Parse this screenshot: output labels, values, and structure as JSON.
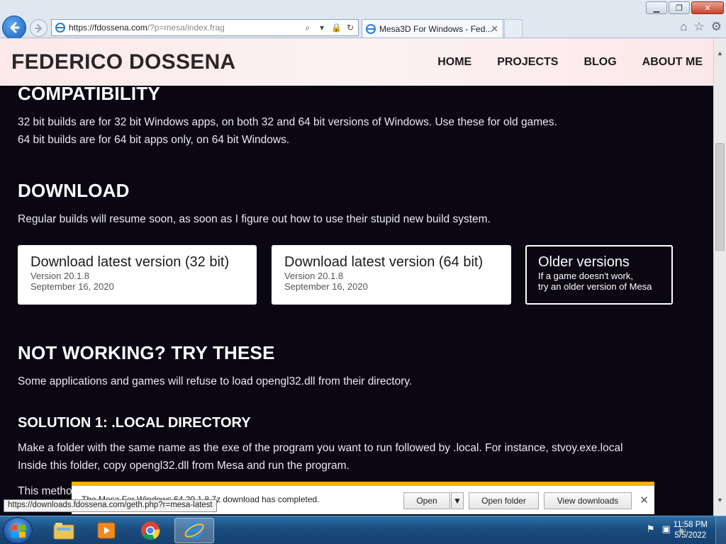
{
  "browser": {
    "url_main": "https://fdossena.com",
    "url_rest": "/?p=mesa/index.frag",
    "tab_title": "Mesa3D For Windows - Fed..."
  },
  "site": {
    "title": "FEDERICO DOSSENA",
    "menu": [
      "HOME",
      "PROJECTS",
      "BLOG",
      "ABOUT ME"
    ]
  },
  "sections": {
    "compatibility": {
      "heading": "COMPATIBILITY",
      "line1": "32 bit builds are for 32 bit Windows apps, on both 32 and 64 bit versions of Windows. Use these for old games.",
      "line2": "64 bit builds are for 64 bit apps only, on 64 bit Windows."
    },
    "download": {
      "heading": "DOWNLOAD",
      "text": "Regular builds will resume soon, as soon as I figure out how to use their stupid new build system.",
      "cards": [
        {
          "title": "Download latest version (32 bit)",
          "line1": "Version 20.1.8",
          "line2": "September 16, 2020"
        },
        {
          "title": "Download latest version (64 bit)",
          "line1": "Version 20.1.8",
          "line2": "September 16, 2020"
        },
        {
          "title": "Older versions",
          "line1": "If a game doesn't work,",
          "line2": "try an older version of Mesa"
        }
      ]
    },
    "notworking": {
      "heading": "NOT WORKING? TRY THESE",
      "text": "Some applications and games will refuse to load opengl32.dll from their directory."
    },
    "solution1": {
      "heading": "SOLUTION 1: .LOCAL DIRECTORY",
      "line1": "Make a folder with the same name as the exe of the program you want to run followed by .local. For instance, stvoy.exe.local",
      "line2": "Inside this folder, copy opengl32.dll from Mesa and run the program.",
      "line3": "This metho"
    }
  },
  "download_bar": {
    "message": "The Mesa For Windows 64 20.1.8.7z download has completed.",
    "open": "Open",
    "open_folder": "Open folder",
    "view_downloads": "View downloads"
  },
  "status_url": "https://downloads.fdossena.com/geth.php?r=mesa-latest",
  "taskbar": {
    "time": "11:58 PM",
    "date": "5/5/2022"
  }
}
